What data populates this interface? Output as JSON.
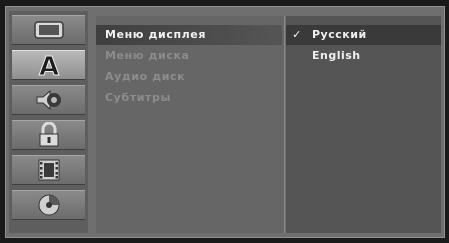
{
  "sidebar": {
    "icons": [
      {
        "name": "display-icon",
        "active": false
      },
      {
        "name": "language-icon",
        "glyph": "A",
        "active": true
      },
      {
        "name": "audio-icon",
        "active": false
      },
      {
        "name": "lock-icon",
        "active": false
      },
      {
        "name": "film-icon",
        "active": false
      },
      {
        "name": "disc-icon",
        "active": false
      }
    ]
  },
  "menu": {
    "items": [
      {
        "label": "Меню дисплея",
        "selected": true
      },
      {
        "label": "Меню диска",
        "selected": false
      },
      {
        "label": "Аудио диск",
        "selected": false
      },
      {
        "label": "Субтитры",
        "selected": false
      }
    ]
  },
  "options": {
    "items": [
      {
        "label": "Русский",
        "check": "✓",
        "selected": true
      },
      {
        "label": "English",
        "check": "",
        "selected": false
      }
    ]
  }
}
